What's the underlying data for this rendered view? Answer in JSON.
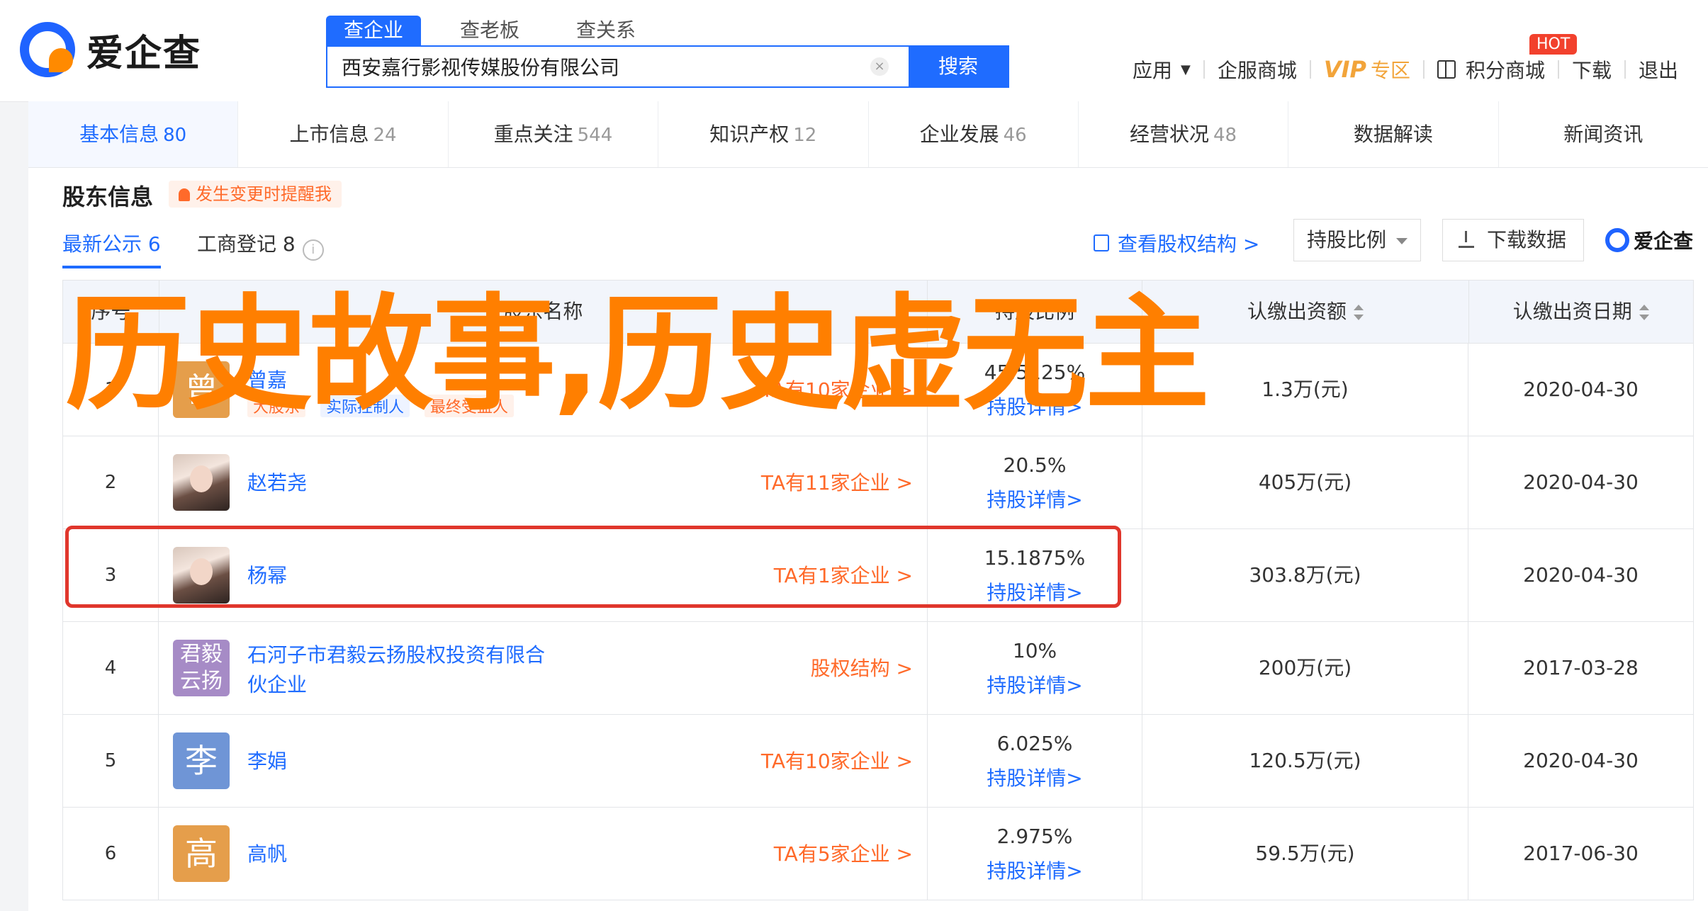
{
  "header": {
    "logo_text": "爱企查",
    "search_tabs": [
      "查企业",
      "查老板",
      "查关系"
    ],
    "search_value": "西安嘉行影视传媒股份有限公司",
    "search_button": "搜索",
    "nav": {
      "app": "应用",
      "enterprise_mall": "企服商城",
      "vip": "VIP",
      "vip_zone": "专区",
      "points_mall": "积分商城",
      "hot": "HOT",
      "partial_item": "下载",
      "logout": "退出"
    }
  },
  "main_tabs": [
    {
      "label": "基本信息",
      "count": "80"
    },
    {
      "label": "上市信息",
      "count": "24"
    },
    {
      "label": "重点关注",
      "count": "544"
    },
    {
      "label": "知识产权",
      "count": "12"
    },
    {
      "label": "企业发展",
      "count": "46"
    },
    {
      "label": "经营状况",
      "count": "48"
    },
    {
      "label": "数据解读",
      "count": ""
    },
    {
      "label": "新闻资讯",
      "count": ""
    }
  ],
  "section": {
    "title": "股东信息",
    "alert": "发生变更时提醒我",
    "sub_tab_active": "最新公示 6",
    "sub_tab_other": "工商登记 8",
    "info_icon": "i",
    "struct_link": "查看股权结构 >",
    "ratio_select": "持股比例",
    "download": "下载数据",
    "mini_logo": "爱企查"
  },
  "table": {
    "headers": [
      "序号",
      "股东名称",
      "持股比例",
      "认缴出资额",
      "认缴出资日期"
    ],
    "rows": [
      {
        "idx": "1",
        "name": "曾嘉",
        "avatar": "曾",
        "tag1": "大股东",
        "tag2": "实际控制人",
        "tag3": "最终受益人",
        "link": "TA有10家企业 >",
        "ratio": "45.5125%",
        "ratio_link": "持股详情>",
        "amount": "1.3万(元)",
        "date": "2020-04-30"
      },
      {
        "idx": "2",
        "name": "赵若尧",
        "avatar": "",
        "link": "TA有11家企业 >",
        "ratio": "20.5%",
        "ratio_link": "持股详情>",
        "amount": "405万(元)",
        "date": "2020-04-30"
      },
      {
        "idx": "3",
        "name": "杨幂",
        "avatar": "",
        "link": "TA有1家企业 >",
        "ratio": "15.1875%",
        "ratio_link": "持股详情>",
        "amount": "303.8万(元)",
        "date": "2020-04-30"
      },
      {
        "idx": "4",
        "name_line1": "石河子市君毅云扬股权投资有限合",
        "name_line2": "伙企业",
        "avatar": "君毅云扬",
        "link": "股权结构 >",
        "ratio": "10%",
        "ratio_link": "持股详情>",
        "amount": "200万(元)",
        "date": "2017-03-28"
      },
      {
        "idx": "5",
        "name": "李娟",
        "avatar": "李",
        "link": "TA有10家企业 >",
        "ratio": "6.025%",
        "ratio_link": "持股详情>",
        "amount": "120.5万(元)",
        "date": "2020-04-30"
      },
      {
        "idx": "6",
        "name": "高帆",
        "avatar": "高",
        "link": "TA有5家企业 >",
        "ratio": "2.975%",
        "ratio_link": "持股详情>",
        "amount": "59.5万(元)",
        "date": "2017-06-30"
      }
    ]
  },
  "overlay_title": "历史故事,历史虚无主",
  "colors": {
    "accent": "#1f6cff",
    "orange": "#ff7f00",
    "link_orange": "#ff6a2a",
    "highlight_red": "#e0362c",
    "vip_gold": "#f2a43a"
  }
}
